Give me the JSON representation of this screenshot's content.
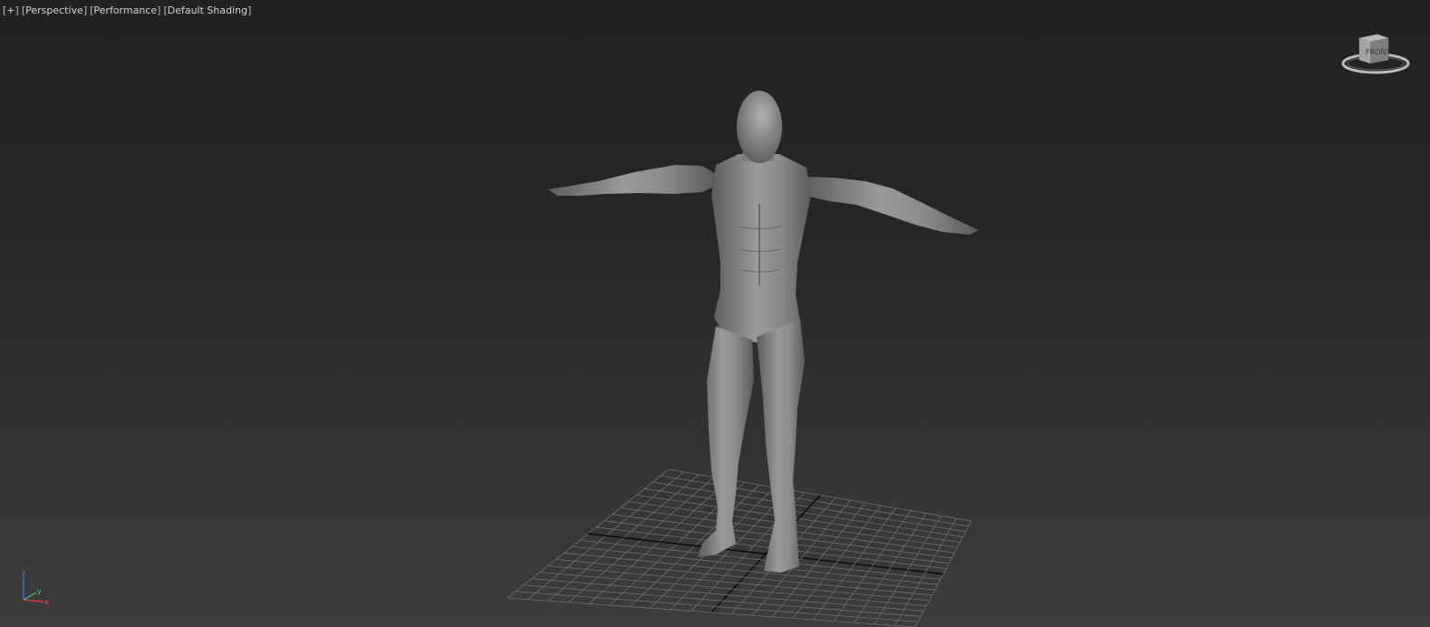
{
  "viewport": {
    "labels": {
      "plus_menu": "+",
      "view_menu": "Perspective",
      "performance_menu": "Performance",
      "shading_menu": "Default Shading"
    },
    "viewcube": {
      "front_face": "FRONT"
    },
    "axis": {
      "z": "z",
      "y": "y",
      "x": "x"
    }
  },
  "colors": {
    "background_top": "#222222",
    "background_bottom": "#3c3c3c",
    "grid": "#6e6e6e",
    "grid_axis": "#0a0a0a",
    "model": "#8c8c8c",
    "axis_x": "#d23a3a",
    "axis_y": "#3ab84a",
    "axis_z": "#3a6ad8"
  }
}
